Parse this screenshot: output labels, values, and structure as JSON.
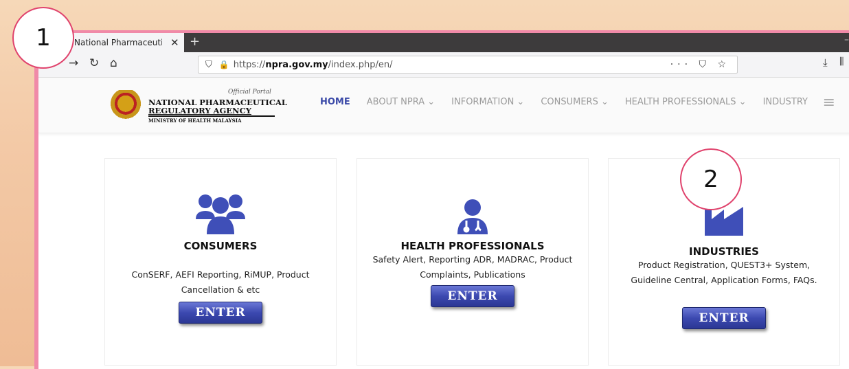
{
  "browser": {
    "tab_title": "National Pharmaceutical Regulatory",
    "new_tab": "+",
    "url_prefix": "https://",
    "url_domain": "npra.gov.my",
    "url_path": "/index.php/en/",
    "url_actions": "··· ⛉ ☆"
  },
  "site": {
    "logo_official": "Official Portal",
    "logo_line1": "NATIONAL PHARMACEUTICAL",
    "logo_line2": "REGULATORY AGENCY",
    "logo_line3": "MINISTRY OF HEALTH MALAYSIA",
    "menu": [
      "HOME",
      "ABOUT NPRA ⌄",
      "INFORMATION ⌄",
      "CONSUMERS ⌄",
      "HEALTH PROFESSIONALS ⌄",
      "INDUSTRY"
    ]
  },
  "cards": [
    {
      "title": "CONSUMERS",
      "desc": "ConSERF, AEFI Reporting, RiMUP, Product Cancellation & etc",
      "button": "ENTER"
    },
    {
      "title": "HEALTH PROFESSIONALS",
      "desc": "Safety Alert, Reporting ADR, MADRAC, Product Complaints, Publications",
      "button": "ENTER"
    },
    {
      "title": "INDUSTRIES",
      "desc": "Product Registration, QUEST3+ System, Guideline Central, Application Forms, FAQs.",
      "button": "ENTER"
    }
  ],
  "annotations": {
    "one": "1",
    "two": "2"
  },
  "colors": {
    "accent": "#3b4aa8",
    "badge_border": "#e0436d",
    "window_border": "#f08aa8"
  }
}
